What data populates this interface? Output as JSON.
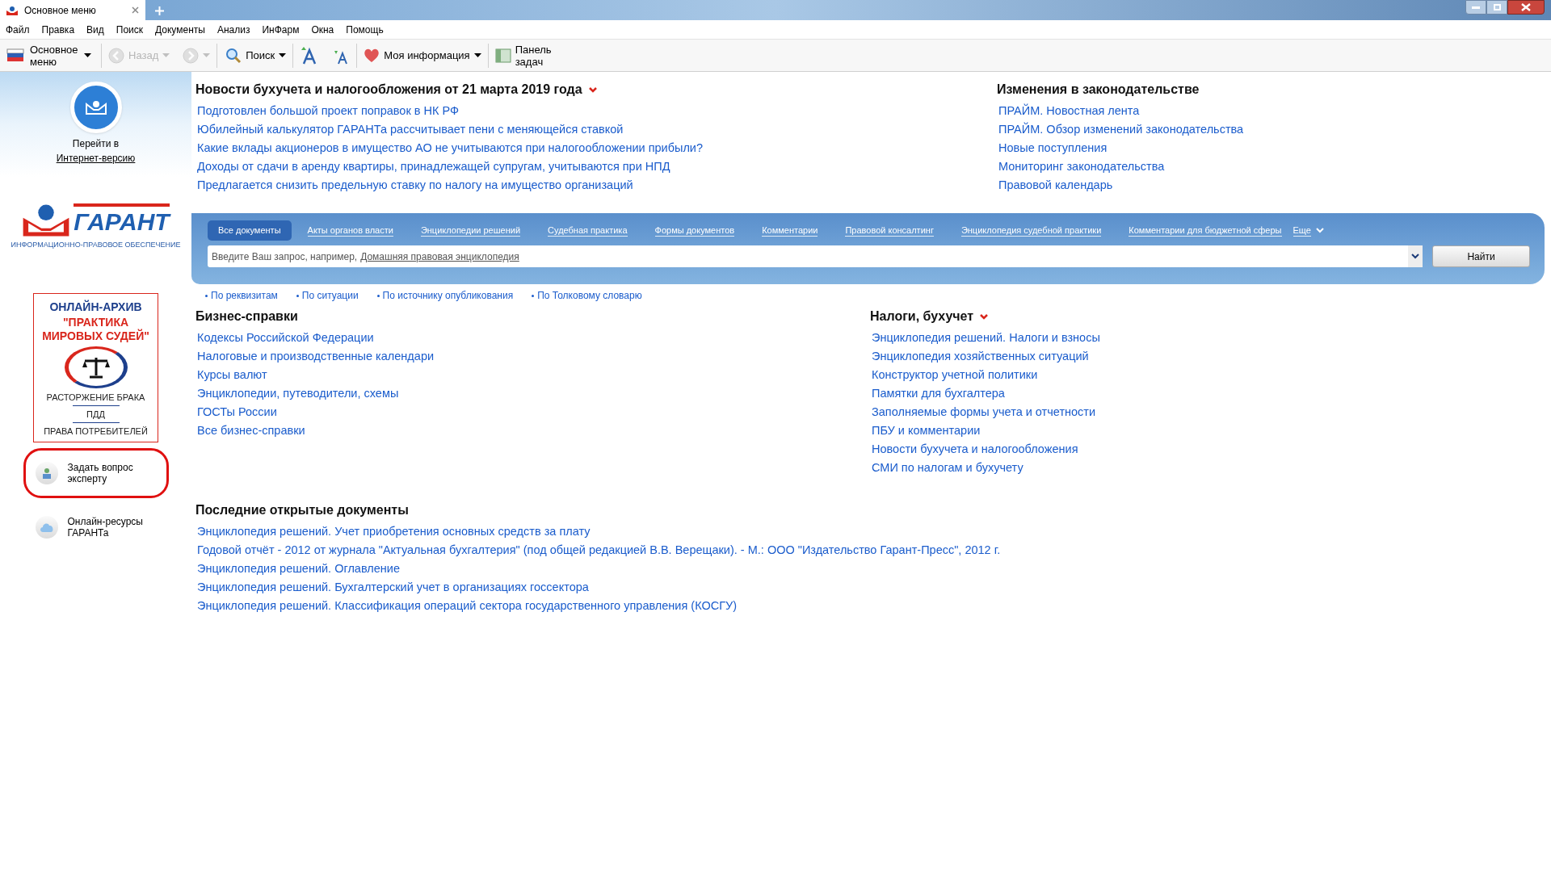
{
  "window": {
    "tab_title": "Основное меню"
  },
  "menu": [
    "Файл",
    "Правка",
    "Вид",
    "Поиск",
    "Документы",
    "Анализ",
    "ИнФарм",
    "Окна",
    "Помощь"
  ],
  "toolbar": [
    {
      "kind": "main",
      "label": "Основное меню",
      "disabled": false
    },
    {
      "kind": "back",
      "label": "Назад",
      "disabled": true
    },
    {
      "kind": "forward",
      "disabled": true
    },
    {
      "kind": "search",
      "label": "Поиск",
      "disabled": false
    },
    {
      "kind": "font_up",
      "disabled": false
    },
    {
      "kind": "font_down",
      "disabled": false
    },
    {
      "kind": "myinfo",
      "label": "Моя информация",
      "disabled": false
    },
    {
      "kind": "taskpanel",
      "label": "Панель задач",
      "disabled": false
    }
  ],
  "sidebar": {
    "internet_link": {
      "line1": "Перейти в",
      "link": "Интернет-версию"
    },
    "logo_caption": "ИНФОРМАЦИОННО-ПРАВОВОЕ ОБЕСПЕЧЕНИЕ",
    "logo_text": "ГАРАНТ",
    "banner": {
      "title": "ОНЛАЙН-АРХИВ",
      "subtitle": "\"ПРАКТИКА МИРОВЫХ СУДЕЙ\"",
      "items": [
        "РАСТОРЖЕНИЕ БРАКА",
        "ПДД",
        "ПРАВА ПОТРЕБИТЕЛЕЙ"
      ]
    },
    "actions": [
      {
        "label": "Задать вопрос эксперту",
        "highlighted": true
      },
      {
        "label": "Онлайн-ресурсы ГАРАНТа",
        "highlighted": false
      }
    ]
  },
  "news": {
    "title": "Новости бухучета и налогообложения от 21 марта 2019 года",
    "links": [
      "Подготовлен большой проект поправок в НК РФ",
      "Юбилейный калькулятор ГАРАНТа рассчитывает пени с меняющейся ставкой",
      "Какие вклады акционеров в имущество АО не учитываются при налогообложении прибыли?",
      "Доходы от сдачи в аренду квартиры, принадлежащей супругам, учитываются при НПД",
      "Предлагается снизить предельную ставку по налогу на имущество организаций"
    ]
  },
  "law_changes": {
    "title": "Изменения в законодательстве",
    "links": [
      "ПРАЙМ. Новостная лента",
      "ПРАЙМ. Обзор изменений законодательства",
      "Новые поступления",
      "Мониторинг законодательства",
      "Правовой календарь"
    ]
  },
  "search": {
    "tabs": [
      {
        "label": "Все документы",
        "selected": true
      },
      {
        "label": "Акты органов власти",
        "selected": false
      },
      {
        "label": "Энциклопедии решений",
        "selected": false
      },
      {
        "label": "Судебная практика",
        "selected": false
      },
      {
        "label": "Формы документов",
        "selected": false
      },
      {
        "label": "Комментарии",
        "selected": false
      },
      {
        "label": "Правовой консалтинг",
        "selected": false
      },
      {
        "label": "Энциклопедия судебной практики",
        "selected": false
      },
      {
        "label": "Комментарии для бюджетной сферы",
        "selected": false
      },
      {
        "label": "Еще",
        "selected": false
      }
    ],
    "placeholder": "Введите Ваш запрос, например,",
    "example": "Домашняя правовая энциклопедия",
    "button": "Найти",
    "quick_links": [
      "По реквизитам",
      "По ситуации",
      "По источнику опубликования",
      "По Толковому словарю"
    ]
  },
  "business": {
    "title": "Бизнес-справки",
    "links": [
      "Кодексы Российской Федерации",
      "Налоговые и производственные календари",
      "Курсы валют",
      "Энциклопедии, путеводители, схемы",
      "ГОСТы России",
      "Все бизнес-справки"
    ]
  },
  "taxes": {
    "title": "Налоги, бухучет",
    "links": [
      "Энциклопедия решений. Налоги и взносы",
      "Энциклопедия хозяйственных ситуаций",
      "Конструктор учетной политики",
      "Памятки для бухгалтера",
      "Заполняемые формы учета и отчетности",
      "ПБУ и комментарии",
      "Новости бухучета и налогообложения",
      "СМИ по налогам и бухучету"
    ]
  },
  "recent": {
    "title": "Последние открытые документы",
    "links": [
      "Энциклопедия решений. Учет приобретения основных средств за плату",
      "Годовой отчёт - 2012 от журнала \"Актуальная бухгалтерия\" (под общей редакцией В.В. Верещаки). - М.: ООО \"Издательство Гарант-Пресс\", 2012 г.",
      "Энциклопедия решений. Оглавление",
      "Энциклопедия решений. Бухгалтерский учет в организациях госсектора",
      "Энциклопедия решений. Классификация операций сектора государственного управления (КОСГУ)"
    ]
  }
}
